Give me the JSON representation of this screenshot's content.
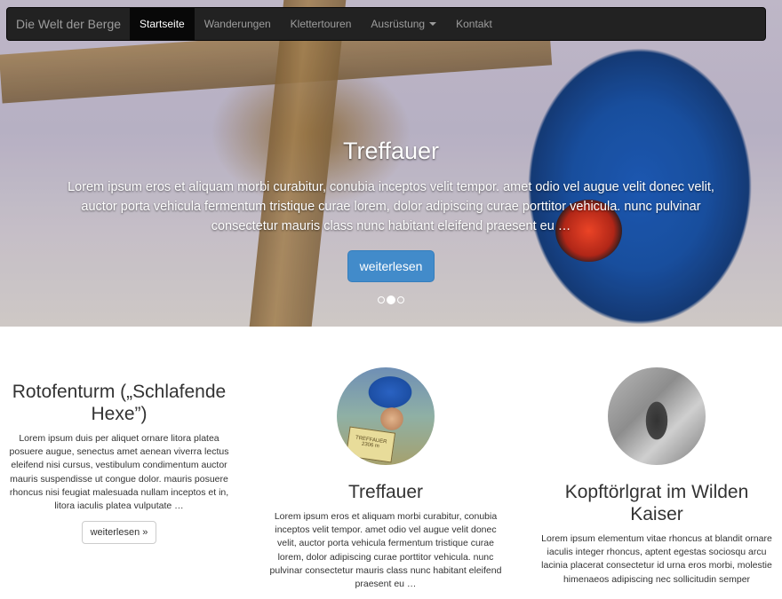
{
  "navbar": {
    "brand": "Die Welt der Berge",
    "items": [
      {
        "label": "Startseite",
        "active": true
      },
      {
        "label": "Wanderungen",
        "active": false
      },
      {
        "label": "Klettertouren",
        "active": false
      },
      {
        "label": "Ausrüstung",
        "active": false,
        "dropdown": true
      },
      {
        "label": "Kontakt",
        "active": false
      }
    ]
  },
  "carousel": {
    "title": "Treffauer",
    "text": "Lorem ipsum eros et aliquam morbi curabitur, conubia inceptos velit tempor. amet odio vel augue velit donec velit, auctor porta vehicula fermentum tristique curae lorem, dolor adipiscing curae porttitor vehicula. nunc pulvinar consectetur mauris class nunc habitant eleifend praesent eu …",
    "button": "weiterlesen",
    "indicators": 3,
    "active_indicator": 1
  },
  "columns": [
    {
      "title": "Rotofenturm („Schlafende Hexe”)",
      "text": "Lorem ipsum duis per aliquet ornare litora platea posuere augue, senectus amet aenean viverra lectus eleifend nisi cursus, vestibulum condimentum auctor mauris suspendisse ut congue dolor. mauris posuere rhoncus nisi feugiat malesuada nullam inceptos et in, litora iaculis platea vulputate …",
      "button": "weiterlesen »"
    },
    {
      "title": "Treffauer",
      "text": "Lorem ipsum eros et aliquam morbi curabitur, conubia inceptos velit tempor. amet odio vel augue velit donec velit, auctor porta vehicula fermentum tristique curae lorem, dolor adipiscing curae porttitor vehicula. nunc pulvinar consectetur mauris class nunc habitant eleifend praesent eu …",
      "image_text": "TREFFAUER 2306 m"
    },
    {
      "title": "Kopftörlgrat im Wilden Kaiser",
      "text": "Lorem ipsum elementum vitae rhoncus at blandit ornare iaculis integer rhoncus, aptent egestas sociosqu arcu lacinia placerat consectetur id urna eros morbi, molestie himenaeos adipiscing nec sollicitudin semper"
    }
  ]
}
